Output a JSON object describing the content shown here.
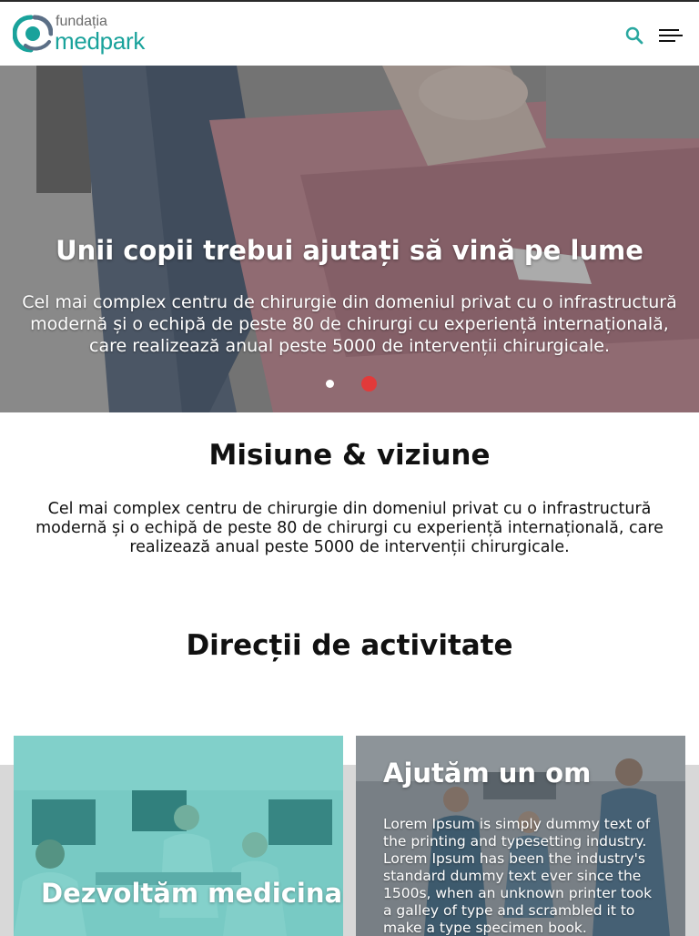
{
  "header": {
    "logo_small": "fundația",
    "logo_big": "medpark",
    "search_icon": "search-icon",
    "menu_icon": "hamburger-menu-icon"
  },
  "hero": {
    "title": "Unii copii trebui ajutați să vină pe lume",
    "text": "Cel mai complex centru de chirurgie din domeniul privat cu o infrastructură modernă și o echipă de peste 80 de chirurgi cu experiență internațională, care realizează anual peste 5000 de intervenții chirurgicale.",
    "slides_total": 2,
    "active_slide": 2
  },
  "mission": {
    "title": "Misiune & viziune",
    "text": "Cel mai complex centru de chirurgie din domeniul privat cu o infrastructură modernă și o echipă de peste 80 de chirurgi cu experiență internațională, care realizează anual peste 5000 de intervenții chirurgicale."
  },
  "directions": {
    "title": "Direcții de activitate",
    "cards": [
      {
        "title": "Dezvoltăm medicina"
      },
      {
        "title": "Ajutăm un om",
        "text": "Lorem Ipsum is simply dummy text of the printing and typesetting industry. Lorem Ipsum has been the industry's standard dummy text ever since the 1500s, when an unknown printer took a galley of type and scrambled it to make a type specimen book."
      }
    ]
  },
  "colors": {
    "brand_teal": "#19a29b",
    "search_icon": "#2aa8a0",
    "active_dot": "#e23a3a"
  }
}
